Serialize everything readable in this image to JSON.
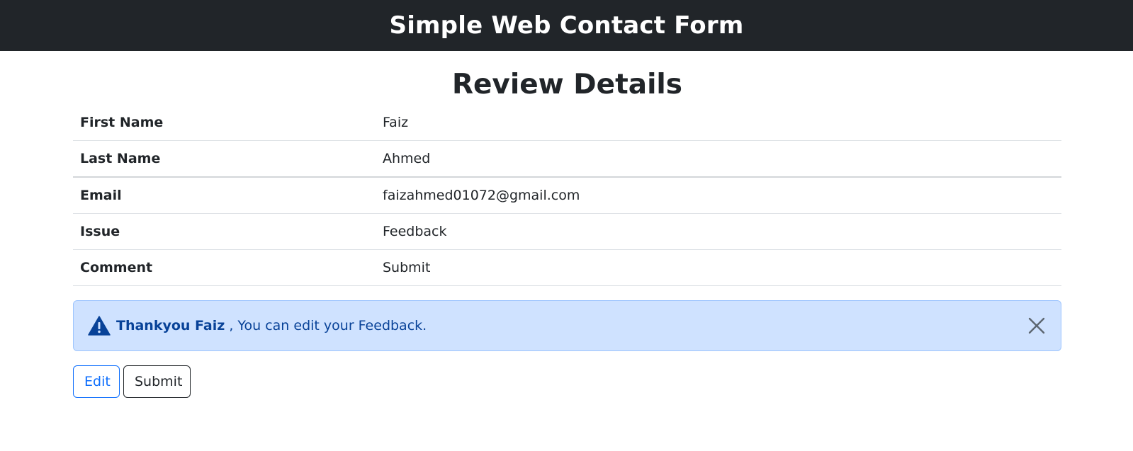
{
  "header": {
    "title": "Simple Web Contact Form"
  },
  "review": {
    "title": "Review Details",
    "rows": [
      {
        "label": "First Name",
        "value": "Faiz"
      },
      {
        "label": "Last Name",
        "value": "Ahmed"
      },
      {
        "label": "Email",
        "value": "faizahmed01072@gmail.com"
      },
      {
        "label": "Issue",
        "value": "Feedback"
      },
      {
        "label": "Comment",
        "value": "Submit"
      }
    ]
  },
  "alert": {
    "icon": "warning-triangle-icon",
    "strong": "Thankyou Faiz",
    "text": " , You can edit your Feedback.",
    "close_icon": "close-icon",
    "color": "#084298",
    "background": "#cfe2ff"
  },
  "actions": {
    "edit_label": "Edit",
    "submit_label": "Submit"
  }
}
